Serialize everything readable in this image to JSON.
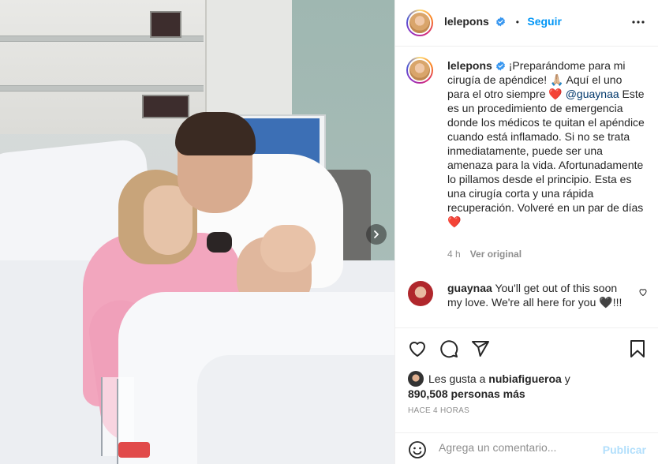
{
  "post": {
    "author": "lelepons",
    "follow_label": "Seguir",
    "separator": "•"
  },
  "caption": {
    "author": "lelepons",
    "text_1": "¡Preparándome para mi cirugía de apéndice! 🙏🏼 Aquí el uno para el otro siempre ❤️ ",
    "mention": "@guaynaa",
    "text_2": " Este es un procedimiento de emergencia donde los médicos te quitan el apéndice cuando está inflamado. Si no se trata inmediatamente, puede ser una amenaza para la vida. Afortunadamente lo pillamos desde el principio. Esta es una cirugía corta y una rápida recuperación. Volveré en un par de días ❤️",
    "age": "4 h",
    "translate_label": "Ver original"
  },
  "reply": {
    "author": "guaynaa",
    "text": " You'll get out of this soon my love. We're all here for you 🖤!!!"
  },
  "likes": {
    "prefix": "Les gusta a ",
    "user": "nubiafigueroa",
    "conj": " y",
    "count_text": "890,508 personas más"
  },
  "timestamp": "HACE 4 HORAS",
  "add_comment": {
    "placeholder": "Agrega un comentario...",
    "publish_label": "Publicar"
  },
  "icons": {
    "verified": "verified-badge-icon",
    "more": "more-options-icon",
    "like": "heart-icon",
    "comment": "comment-icon",
    "share": "share-icon",
    "save": "bookmark-icon",
    "emoji": "emoji-icon",
    "next": "chevron-right-icon"
  },
  "colors": {
    "accent": "#0095f6",
    "verified": "#3897f0",
    "publish_disabled": "#b2dffc",
    "muted": "#8e8e8e"
  }
}
